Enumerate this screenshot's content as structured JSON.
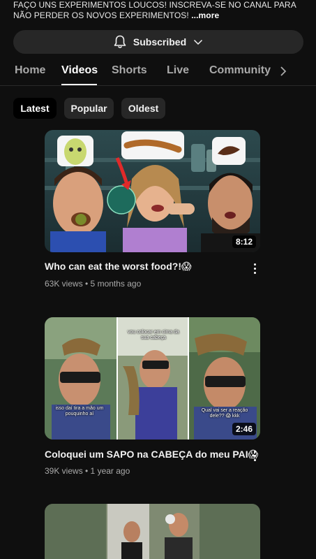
{
  "channel": {
    "description": "FAÇO UNS EXPERIMENTOS LOUCOS! INSCREVA-SE NO CANAL PARA NÃO PERDER OS NOVOS EXPERIMENTOS!",
    "more_label": "...more"
  },
  "subscribe": {
    "label": "Subscribed",
    "bell_icon": "bell-icon",
    "chevron_icon": "chevron-down-icon"
  },
  "tabs": [
    {
      "label": "Home"
    },
    {
      "label": "Videos"
    },
    {
      "label": "Shorts"
    },
    {
      "label": "Live"
    },
    {
      "label": "Community"
    }
  ],
  "active_tab": "Videos",
  "filters": [
    {
      "label": "Latest"
    },
    {
      "label": "Popular"
    },
    {
      "label": "Oldest"
    }
  ],
  "active_filter": "Latest",
  "videos": [
    {
      "title": "Who can eat the worst food?!😱",
      "meta": "63K views • 5 months ago",
      "duration": "8:12"
    },
    {
      "title": "Coloquei um SAPO na CABEÇA do meu PAI😱",
      "meta": "39K views • 1 year ago",
      "duration": "2:46",
      "captions": [
        "isso daí tira a mão um pouquinho aí",
        "vou colocar em cima da sua cabeça",
        "Qual vai ser a reação dele?? 😱 kkk"
      ]
    },
    {
      "title": "",
      "meta": "",
      "duration": ""
    }
  ],
  "colors": {
    "background": "#0f0f0f",
    "chip": "#272727",
    "text": "#f1f1f1",
    "muted": "#aaaaaa"
  }
}
